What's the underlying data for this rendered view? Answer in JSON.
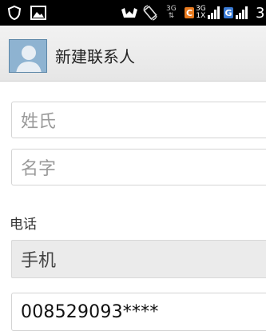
{
  "status_bar": {
    "icons": [
      "shield-icon",
      "image-icon",
      "vibrate-icon",
      "rotate-icon",
      "network-3g-icon",
      "carrier-c-icon",
      "network-3g-1x-icon",
      "signal-bars-icon",
      "carrier-g-icon",
      "signal-bars-icon"
    ],
    "net1_top": "3G",
    "net1_bottom": "⇅",
    "carrier_c": "C",
    "net2_top": "3G",
    "net2_bottom": "1X",
    "carrier_g": "G",
    "time": "3"
  },
  "header": {
    "title": "新建联系人"
  },
  "form": {
    "surname_placeholder": "姓氏",
    "given_name_placeholder": "名字",
    "phone_section_label": "电话",
    "phone_type": "手机",
    "phone_value": "008529093****"
  },
  "colors": {
    "statusbar_bg": "#000000",
    "carrier_c": "#e87a1e",
    "carrier_g": "#3a7bd5",
    "avatar_bg": "#7ba6c8"
  }
}
